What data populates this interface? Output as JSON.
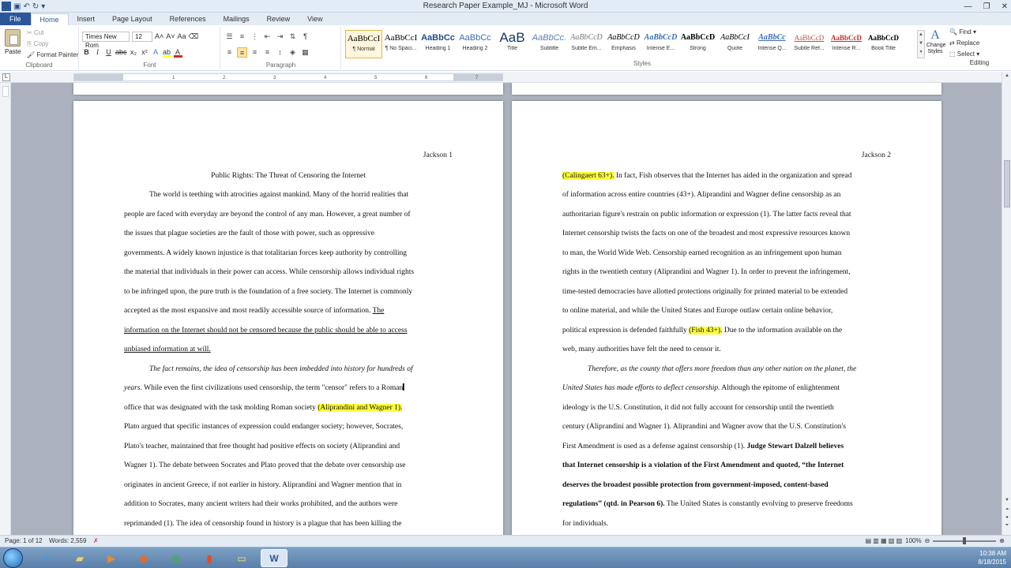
{
  "window": {
    "title": "Research Paper Example_MJ - Microsoft Word"
  },
  "tabs": [
    "File",
    "Home",
    "Insert",
    "Page Layout",
    "References",
    "Mailings",
    "Review",
    "View"
  ],
  "clipboard": {
    "paste": "Paste",
    "cut": "Cut",
    "copy": "Copy",
    "format_painter": "Format Painter",
    "label": "Clipboard"
  },
  "font": {
    "name": "Times New Rom",
    "size": "12",
    "label": "Font"
  },
  "paragraph": {
    "label": "Paragraph"
  },
  "styles": {
    "label": "Styles",
    "items": [
      {
        "preview": "AaBbCcI",
        "name": "¶ Normal"
      },
      {
        "preview": "AaBbCcI",
        "name": "¶ No Spaci..."
      },
      {
        "preview": "AaBbCc",
        "name": "Heading 1"
      },
      {
        "preview": "AaBbCc",
        "name": "Heading 2"
      },
      {
        "preview": "AaB",
        "name": "Title"
      },
      {
        "preview": "AaBbCc.",
        "name": "Subtitle"
      },
      {
        "preview": "AaBbCcD",
        "name": "Subtle Em..."
      },
      {
        "preview": "AaBbCcD",
        "name": "Emphasis"
      },
      {
        "preview": "AaBbCcD",
        "name": "Intense E..."
      },
      {
        "preview": "AaBbCcD",
        "name": "Strong"
      },
      {
        "preview": "AaBbCcI",
        "name": "Quote"
      },
      {
        "preview": "AaBbCc",
        "name": "Intense Q..."
      },
      {
        "preview": "AaBbCcD",
        "name": "Subtle Ref..."
      },
      {
        "preview": "AaBbCcD",
        "name": "Intense R..."
      },
      {
        "preview": "AaBbCcD",
        "name": "Book Title"
      }
    ],
    "change_styles": "Change Styles"
  },
  "editing": {
    "find": "Find",
    "replace": "Replace",
    "select": "Select",
    "label": "Editing"
  },
  "ruler": {
    "ticks": [
      "1",
      "2",
      "3",
      "4",
      "5",
      "6",
      "7"
    ]
  },
  "page1": {
    "header": "Jackson 1",
    "title": "Public Rights:  The Threat of Censoring the Internet",
    "lines": [
      "The world is teething with atrocities against mankind.  Many of the horrid realities that",
      "people are faced with everyday are beyond the control of any man.  However, a great number of",
      "the issues that plague societies are the fault of those with power, such as oppressive",
      "governments.  A widely known injustice is that totalitarian forces keep authority by controlling",
      "the material that individuals in their power can access.  While censorship allows individual rights",
      "to be infringed upon, the pure truth is the foundation of a free society.  The Internet is commonly",
      "accepted as the most expansive and most readily accessible source of information.",
      "The",
      "information on the Internet should not be censored because the public should be able to access",
      "unbiased information at will.",
      "The fact remains, the idea of censorship has been imbedded into history for hundreds of",
      "years.",
      "While even the first civilizations used censorship, the term \"censor\" refers to a Roman",
      "office that was designated with the task molding Roman society",
      "(Aliprandini and Wagner 1).",
      "Plato argued that specific instances of expression could endanger society; however, Socrates,",
      "Plato's teacher, maintained that free thought had positive effects on society (Aliprandini and",
      "Wagner 1).  The debate between Socrates and Plato proved that the debate over censorship use",
      "originates in ancient Greece, if not earlier in history.  Aliprandini and Wagner mention that in",
      "addition to Socrates, many ancient writers had their works prohibited, and the authors were",
      "reprimanded (1).  The idea of censorship found in history is a plague that has been killing the"
    ]
  },
  "page2": {
    "header": "Jackson 2",
    "lines": [
      "(Calingaert 63+).",
      "In fact, Fish observes that the Internet has aided in the organization and spread",
      "of information across entire countries (43+).  Aliprandini and Wagner define censorship as an",
      "authoritarian figure's restrain on public information or expression (1).  The latter facts reveal that",
      "Internet censorship twists the facts on one of the broadest and most expressive resources known",
      "to man, the World Wide Web.  Censorship earned recognition as an infringement upon human",
      "rights in the twentieth century (Aliprandini and Wagner 1).  In order to prevent the infringement,",
      "time-tested democracies have allotted protections originally for printed material to be extended",
      "to online material, and while the United States and Europe outlaw certain online behavior,",
      "political expression is defended faithfully",
      "(Fish 43+).",
      "Due to the information available on the",
      "web, many authorities have felt the need to censor it.",
      "Therefore, as the county that offers more freedom than any other nation on the planet, the",
      "United States has made efforts to deflect censorship.",
      "Although the epitome of enlightenment",
      "ideology is the U.S. Constitution, it did not fully account for censorship until the twentieth",
      "century (Aliprandini and Wagner 1).  Aliprandini and Wagner avow that the U.S. Constitution's",
      "First Amendment is used as a defense against censorship (1).",
      "Judge Stewart Dalzell believes",
      "that Internet censorship is a violation of the First Amendment and quoted, “the Internet",
      "deserves the broadest possible protection from government-imposed, content-based",
      "regulations” (qtd. in Pearson 6).",
      "The United States is constantly evolving to preserve freedoms",
      "for individuals."
    ]
  },
  "status": {
    "page": "Page: 1 of 12",
    "words": "Words: 2,559",
    "zoom": "100%"
  },
  "tray": {
    "time": "10:38 AM",
    "date": "8/18/2015"
  },
  "colors": {
    "accent": "#2b579a",
    "highlight": "#ffff3a",
    "workspace": "#abb2bd"
  }
}
